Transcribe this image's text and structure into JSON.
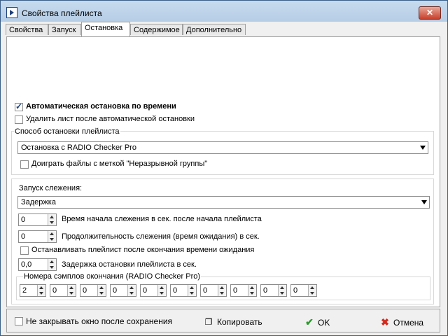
{
  "window": {
    "title": "Свойства плейлиста"
  },
  "tabs": [
    "Свойства",
    "Запуск",
    "Остановка",
    "Содержимое",
    "Дополнительно"
  ],
  "stop": {
    "auto_stop_label": "Автоматическая остановка по времени",
    "auto_stop_checked": true,
    "delete_after_label": "Удалить лист после автоматической остановки",
    "method_group_title": "Способ остановки плейлиста",
    "method_value": "Остановка с RADIO Checker Pro",
    "finish_group_label": "Доиграть файлы с меткой \"Неразрывной группы\"",
    "tracking_title": "Запуск слежения:",
    "tracking_value": "Задержка",
    "start_time_value": "0",
    "start_time_label": "Время начала слежения в сек. после начала плейлиста",
    "duration_value": "0",
    "duration_label": "Продолжительность слежения (время ожидания) в сек.",
    "stop_after_label": "Останавливать плейлист после окончания времени ожидания",
    "delay_value": "0,0",
    "delay_label": "Задержка остановки плейлиста в сек.",
    "samples_title": "Номера сэмплов окончания (RADIO Checker Pro)",
    "samples": [
      "2",
      "0",
      "0",
      "0",
      "0",
      "0",
      "0",
      "0",
      "0",
      "0"
    ]
  },
  "footer": {
    "keep_open_label": "Не закрывать окно после сохранения",
    "copy_label": "Копировать",
    "ok_label": "OK",
    "cancel_label": "Отмена"
  },
  "colors": {
    "ok_icon": "#2e9b2e",
    "cancel_icon": "#d42a1e"
  }
}
